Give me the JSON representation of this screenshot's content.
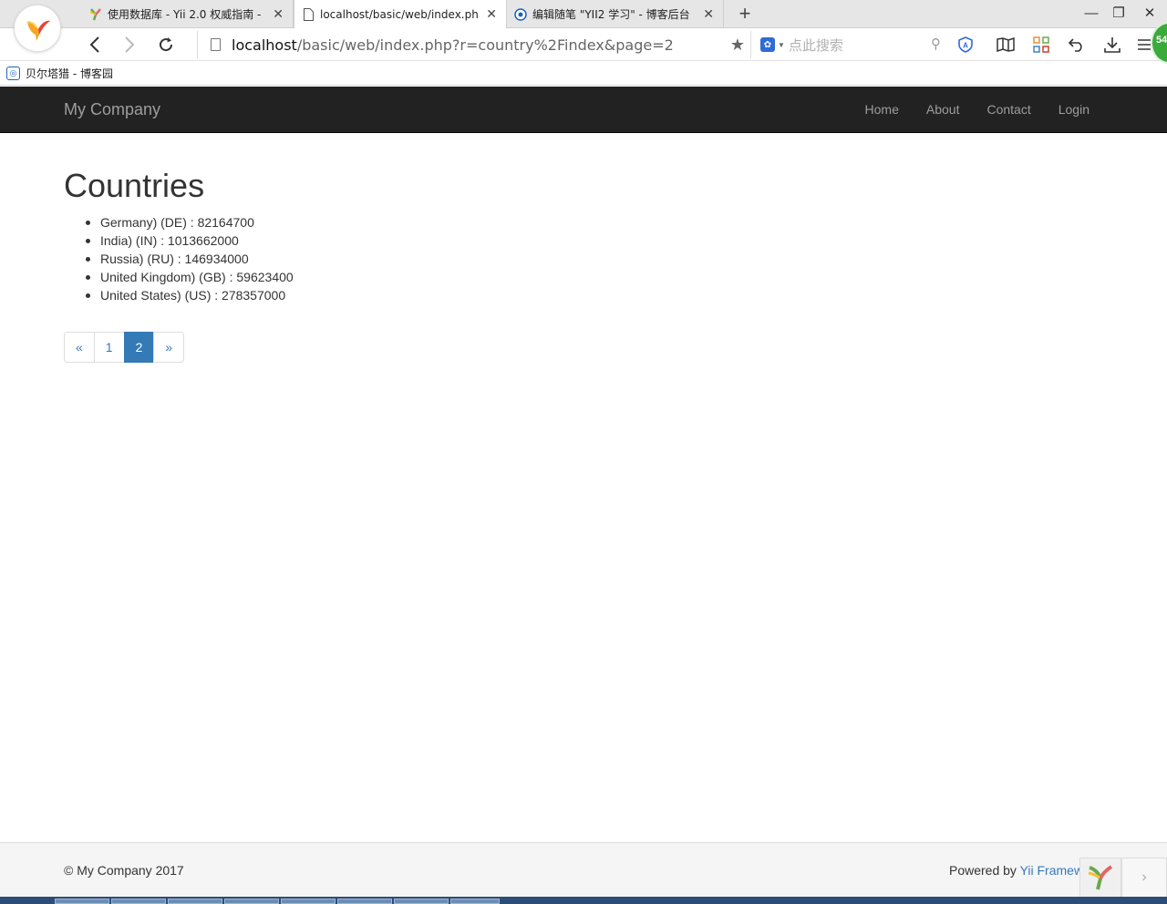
{
  "browser": {
    "tabs": [
      {
        "title": "使用数据库 - Yii 2.0 权威指南 - ",
        "icon": "yii-icon"
      },
      {
        "title": "localhost/basic/web/index.php",
        "icon": "page-icon"
      },
      {
        "title": "编辑随笔 \"YII2 学习\" - 博客后台",
        "icon": "cnblogs-icon"
      }
    ],
    "new_tab": "+",
    "address": {
      "host": "localhost",
      "path": "/basic/web/index.php?r=country%2Findex&page=2"
    },
    "search_placeholder": "点此搜索",
    "badge": "54",
    "bookmarks": [
      {
        "label": "贝尔塔猎 - 博客园"
      }
    ]
  },
  "site": {
    "brand": "My Company",
    "menu": [
      "Home",
      "About",
      "Contact",
      "Login"
    ],
    "title": "Countries",
    "countries": [
      "Germany) (DE) : 82164700",
      "India) (IN) : 1013662000",
      "Russia) (RU) : 146934000",
      "United Kingdom) (GB) : 59623400",
      "United States) (US) : 278357000"
    ],
    "pagination": {
      "prev": "«",
      "pages": [
        "1",
        "2"
      ],
      "current": "2",
      "next": "»"
    },
    "footer": {
      "copyright": "© My Company 2017",
      "powered_prefix": "Powered by ",
      "powered_link": "Yii Framew"
    }
  },
  "colors": {
    "navbar": "#222222",
    "link": "#337ab7",
    "footer_bg": "#f5f5f5"
  }
}
